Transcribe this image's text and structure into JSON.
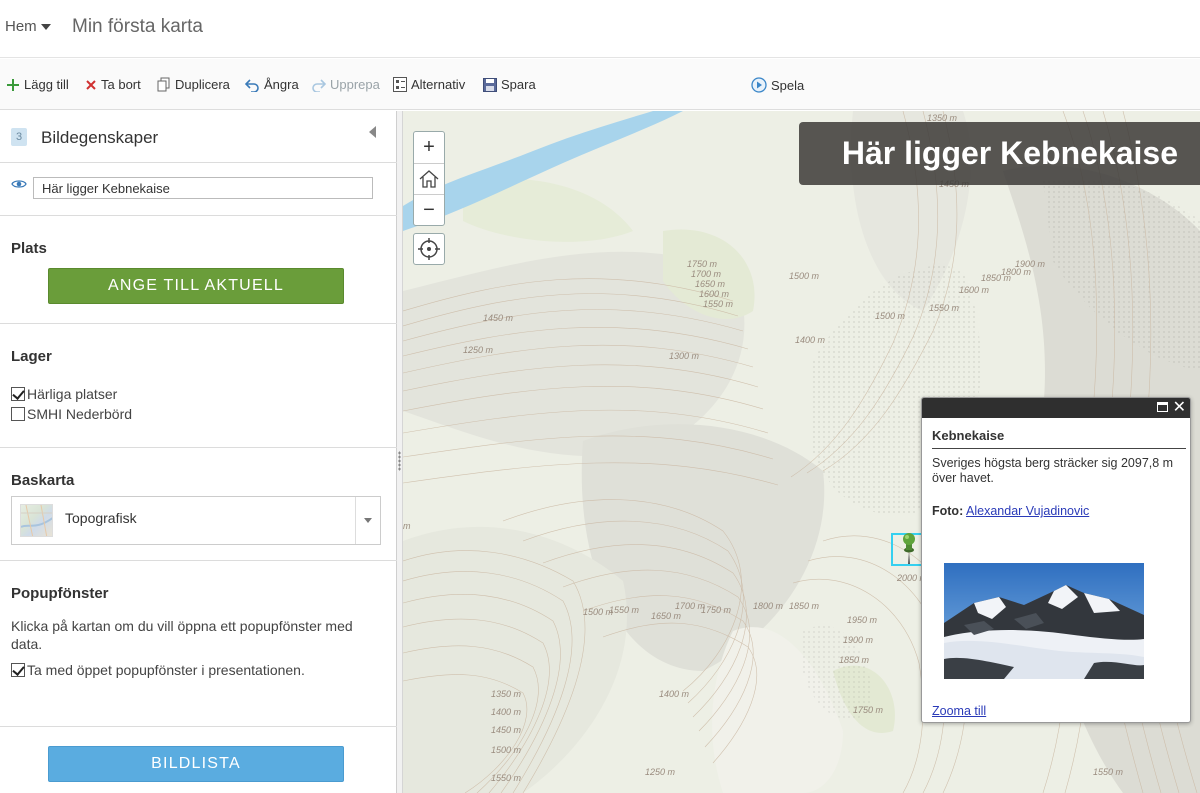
{
  "header": {
    "home_label": "Hem",
    "map_title": "Min första karta"
  },
  "toolbar": {
    "add": "Lägg till",
    "remove": "Ta bort",
    "duplicate": "Duplicera",
    "undo": "Ångra",
    "redo": "Upprepa",
    "options": "Alternativ",
    "save": "Spara",
    "play": "Spela"
  },
  "panel": {
    "slide_number": "3",
    "slide_heading": "Bildegenskaper",
    "slide_title_value": "Här ligger Kebnekaise",
    "location": {
      "heading": "Plats",
      "set_current_button": "ANGE TILL AKTUELL"
    },
    "layers": {
      "heading": "Lager",
      "items": [
        {
          "label": "Härliga platser",
          "checked": true
        },
        {
          "label": "SMHI Nederbörd",
          "checked": false
        }
      ]
    },
    "basemap": {
      "heading": "Baskarta",
      "selected": "Topografisk"
    },
    "popup": {
      "heading": "Popupfönster",
      "description": "Klicka på kartan om du vill öppna ett popupfönster med data.",
      "include_label": "Ta med öppet popupfönster i presentationen.",
      "include_checked": true
    },
    "slide_list_button": "BILDLISTA"
  },
  "map": {
    "title_banner": "Här ligger Kebnekaise",
    "zoom_in": "+",
    "zoom_out": "−",
    "contour_labels": [
      "1350 m",
      "1450 m",
      "1750 m",
      "1700 m",
      "1650 m",
      "1600 m",
      "1550 m",
      "1500 m",
      "1450 m",
      "1250 m",
      "1300 m",
      "1400 m",
      "1550 m",
      "1500 m",
      "1600 m",
      "1800 m",
      "1850 m",
      "1900 m",
      "2000 m",
      "1500 m",
      "1550 m",
      "1650 m",
      "1700 m",
      "1750 m",
      "1800 m",
      "1850 m",
      "1950 m",
      "1900 m",
      "1850 m",
      "1350 m",
      "1400 m",
      "1450 m",
      "1500 m",
      "1550 m",
      "1400 m",
      "1750 m",
      "1250 m",
      "1550 m",
      "m"
    ],
    "popup": {
      "title": "Kebnekaise",
      "description": "Sveriges högsta berg sträcker sig 2097,8 m över havet.",
      "photo_label": "Foto:",
      "photo_credit": "Alexandar Vujadinovic",
      "zoom_link": "Zooma till"
    }
  },
  "colors": {
    "green_button": "#6a9d3a",
    "blue_button": "#5aace0",
    "pin_highlight": "#35d0f0",
    "banner_bg": "#3c3a37"
  }
}
